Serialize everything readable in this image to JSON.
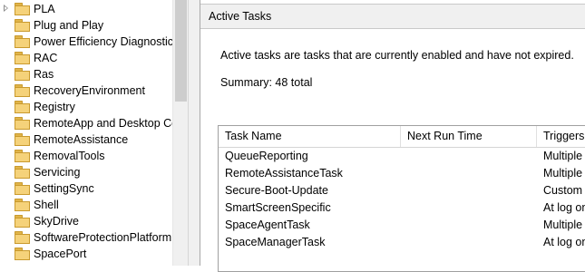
{
  "tree": {
    "items": [
      {
        "label": "PLA",
        "expandable": true
      },
      {
        "label": "Plug and Play",
        "expandable": false
      },
      {
        "label": "Power Efficiency Diagnostics",
        "expandable": false
      },
      {
        "label": "RAC",
        "expandable": false
      },
      {
        "label": "Ras",
        "expandable": false
      },
      {
        "label": "RecoveryEnvironment",
        "expandable": false
      },
      {
        "label": "Registry",
        "expandable": false
      },
      {
        "label": "RemoteApp and Desktop Cor",
        "expandable": false
      },
      {
        "label": "RemoteAssistance",
        "expandable": false
      },
      {
        "label": "RemovalTools",
        "expandable": false
      },
      {
        "label": "Servicing",
        "expandable": false
      },
      {
        "label": "SettingSync",
        "expandable": false
      },
      {
        "label": "Shell",
        "expandable": false
      },
      {
        "label": "SkyDrive",
        "expandable": false
      },
      {
        "label": "SoftwareProtectionPlatform",
        "expandable": false
      },
      {
        "label": "SpacePort",
        "expandable": false
      }
    ]
  },
  "panel": {
    "title": "Active Tasks",
    "description": "Active tasks are tasks that are currently enabled and have not expired.",
    "summary": "Summary: 48 total"
  },
  "grid": {
    "columns": [
      "Task Name",
      "Next Run Time",
      "Triggers"
    ],
    "rows": [
      {
        "name": "QueueReporting",
        "next": "",
        "triggers": "Multiple t"
      },
      {
        "name": "RemoteAssistanceTask",
        "next": "",
        "triggers": "Multiple t"
      },
      {
        "name": "Secure-Boot-Update",
        "next": "",
        "triggers": "Custom T"
      },
      {
        "name": "SmartScreenSpecific",
        "next": "",
        "triggers": "At log on"
      },
      {
        "name": "SpaceAgentTask",
        "next": "",
        "triggers": "Multiple t"
      },
      {
        "name": "SpaceManagerTask",
        "next": "",
        "triggers": "At log on"
      }
    ]
  },
  "colors": {
    "folder": "#f5d27a",
    "panel_header": "#f0f0f0",
    "border": "#a0a0a0"
  }
}
